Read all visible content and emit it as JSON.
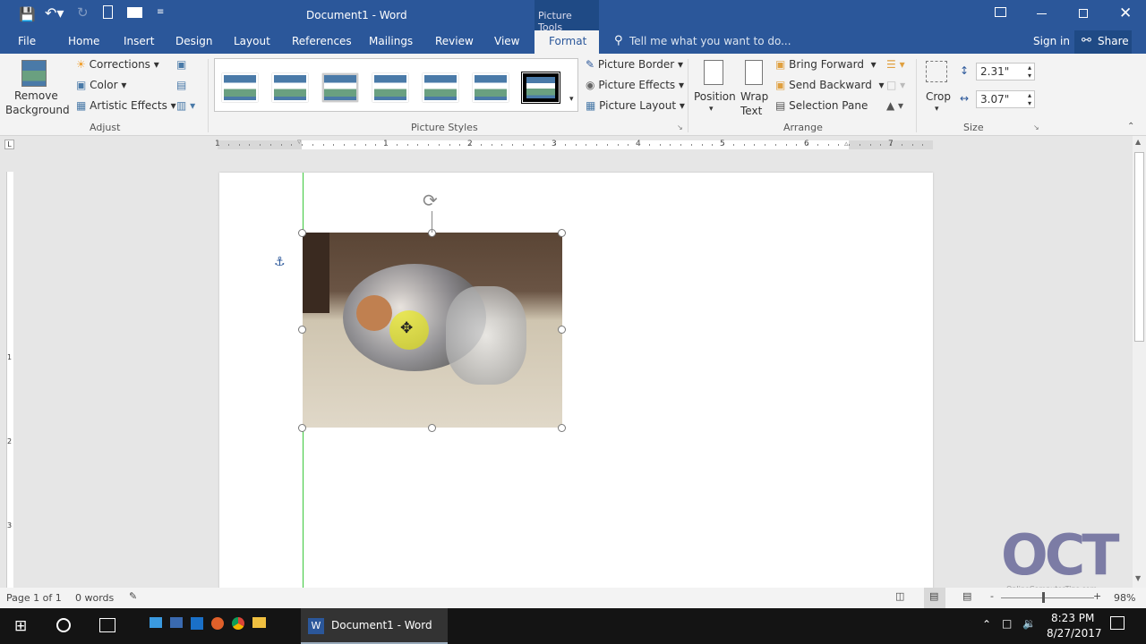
{
  "titlebar": {
    "title": "Document1 - Word",
    "context_tab": "Picture Tools",
    "icons": [
      "save-icon",
      "undo-icon",
      "redo-icon",
      "new-icon",
      "open-icon",
      "customize-icon"
    ],
    "window_controls": [
      "ribbon-display-icon",
      "minimize-icon",
      "restore-icon",
      "close-icon"
    ]
  },
  "tabs": [
    {
      "label": "File"
    },
    {
      "label": "Home"
    },
    {
      "label": "Insert"
    },
    {
      "label": "Design"
    },
    {
      "label": "Layout"
    },
    {
      "label": "References"
    },
    {
      "label": "Mailings"
    },
    {
      "label": "Review"
    },
    {
      "label": "View"
    },
    {
      "label": "Format",
      "active": true
    }
  ],
  "tell_me": "Tell me what you want to do...",
  "sign_in": "Sign in",
  "share": "Share",
  "ribbon": {
    "adjust": {
      "remove_bg_1": "Remove",
      "remove_bg_2": "Background",
      "corrections": "Corrections",
      "color": "Color",
      "artistic": "Artistic Effects",
      "group": "Adjust"
    },
    "styles": {
      "group": "Picture Styles",
      "border": "Picture Border",
      "effects": "Picture Effects",
      "layout": "Picture Layout"
    },
    "arrange": {
      "position": "Position",
      "wrap_1": "Wrap",
      "wrap_2": "Text",
      "bring": "Bring Forward",
      "send": "Send Backward",
      "selection": "Selection Pane",
      "group": "Arrange"
    },
    "size": {
      "crop": "Crop",
      "height": "2.31\"",
      "width": "3.07\"",
      "group": "Size"
    }
  },
  "ruler": {
    "labels": [
      "1",
      "1",
      "2",
      "3",
      "4",
      "5",
      "6",
      "7"
    ],
    "vlabels": [
      "1",
      "2",
      "3"
    ]
  },
  "logo": {
    "text": "OCT",
    "sub": "OnlineComputerTips.com"
  },
  "status": {
    "page": "Page 1 of 1",
    "words": "0 words",
    "zoom": "98%"
  },
  "taskbar": {
    "app": "Document1 - Word",
    "time": "8:23 PM",
    "date": "8/27/2017"
  },
  "colors": {
    "brand": "#2b579a",
    "selection_line": "#3cc83c",
    "highlight": "#e6e600"
  }
}
